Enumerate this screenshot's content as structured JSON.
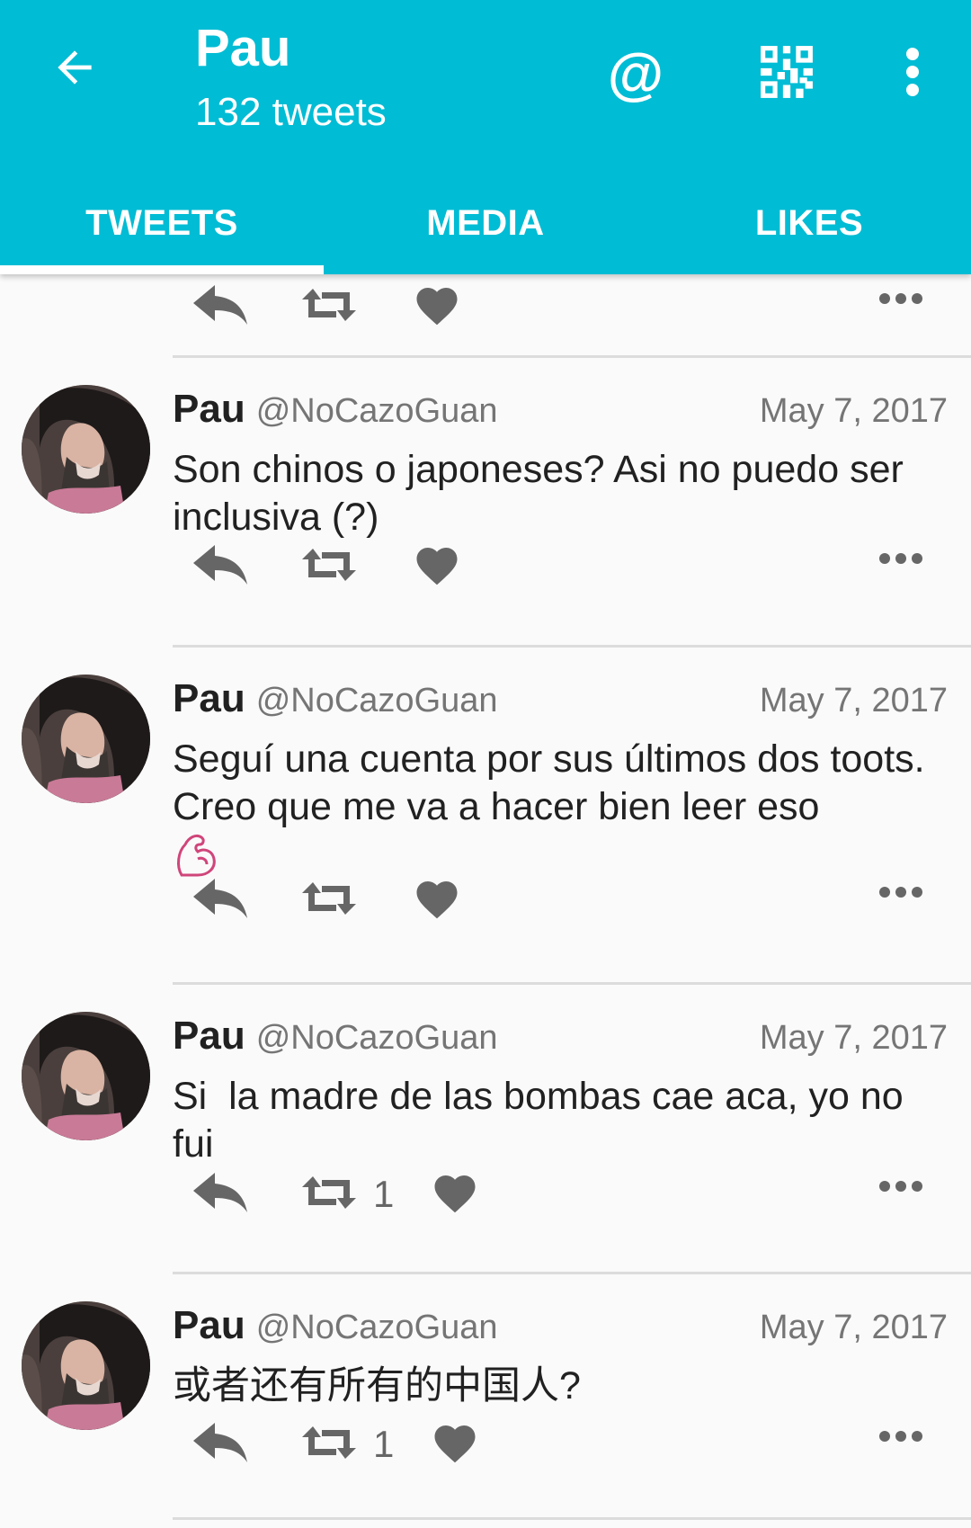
{
  "app_bar": {
    "title": "Pau",
    "subtitle": "132 tweets",
    "background_color": "#00bcd4",
    "icons": [
      "arrow-back-icon",
      "mention-icon",
      "qr-code-icon",
      "more-vert-icon"
    ],
    "mention_glyph": "@"
  },
  "tabs": [
    {
      "label": "TWEETS",
      "active": true
    },
    {
      "label": "MEDIA",
      "active": false
    },
    {
      "label": "LIKES",
      "active": false
    }
  ],
  "tweets": [
    {
      "name": "Pau",
      "handle": "@NoCazoGuan",
      "date": "May 7, 2017",
      "text": "Son chinos o japoneses? Asi no puedo ser inclusiva (?)",
      "retweets": ""
    },
    {
      "name": "Pau",
      "handle": "@NoCazoGuan",
      "date": "May 7, 2017",
      "text": "Seguí una cuenta por sus últimos dos toots. Creo que me va a hacer bien leer eso",
      "emoji_icon": "flexed-biceps-icon",
      "retweets": ""
    },
    {
      "name": "Pau",
      "handle": "@NoCazoGuan",
      "date": "May 7, 2017",
      "text": "Si  la madre de las bombas cae aca, yo no fui",
      "retweets": "1"
    },
    {
      "name": "Pau",
      "handle": "@NoCazoGuan",
      "date": "May 7, 2017",
      "text": "或者还有所有的中国人?",
      "retweets": "1"
    }
  ]
}
